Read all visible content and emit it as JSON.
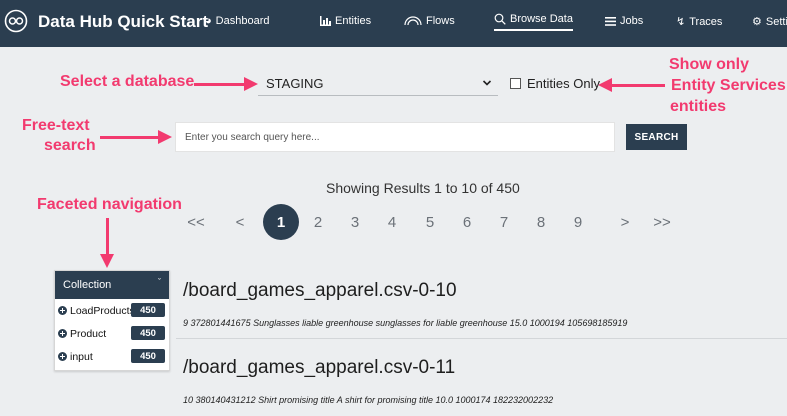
{
  "app": {
    "title": "Data Hub Quick Start"
  },
  "nav": {
    "items": [
      {
        "label": "Dashboard",
        "icon": "dashboard-icon"
      },
      {
        "label": "Entities",
        "icon": "bar-chart-icon"
      },
      {
        "label": "Flows",
        "icon": "flows-icon"
      },
      {
        "label": "Browse Data",
        "icon": "search-icon",
        "active": true
      },
      {
        "label": "Jobs",
        "icon": "list-icon"
      },
      {
        "label": "Traces",
        "icon": "bolt-icon"
      },
      {
        "label": "Setti",
        "icon": "gear-icon"
      }
    ]
  },
  "annotations": {
    "select_db": "Select a database",
    "free_text_1": "Free-text",
    "free_text_2": "search",
    "show_only_1": "Show only",
    "show_only_2": "Entity Services",
    "show_only_3": "entities",
    "faceted": "Faceted navigation"
  },
  "database": {
    "selected": "STAGING"
  },
  "entities_only": {
    "label": "Entities Only",
    "checked": false
  },
  "search": {
    "placeholder": "Enter you search query here...",
    "button_label": "SEARCH"
  },
  "results_summary": "Showing Results 1 to 10 of 450",
  "pagination": {
    "first": "<<",
    "prev": "<",
    "pages": [
      "1",
      "2",
      "3",
      "4",
      "5",
      "6",
      "7",
      "8",
      "9"
    ],
    "current": "1",
    "next": ">",
    "last": ">>"
  },
  "facet": {
    "header": "Collection",
    "items": [
      {
        "label": "LoadProducts",
        "count": "450"
      },
      {
        "label": "Product",
        "count": "450"
      },
      {
        "label": "input",
        "count": "450"
      }
    ]
  },
  "results": [
    {
      "title": "/board_games_apparel.csv-0-10",
      "snippet": "9 372801441675 Sunglasses liable greenhouse sunglasses for liable greenhouse 15.0 1000194 105698185919"
    },
    {
      "title": "/board_games_apparel.csv-0-11",
      "snippet": "10 380140431212 Shirt promising title A shirt for promising title 10.0 1000174 182232002232"
    }
  ],
  "colors": {
    "nav_bg": "#2b3e50",
    "accent_red": "#f23a6f",
    "page_bg": "#eceef0"
  }
}
